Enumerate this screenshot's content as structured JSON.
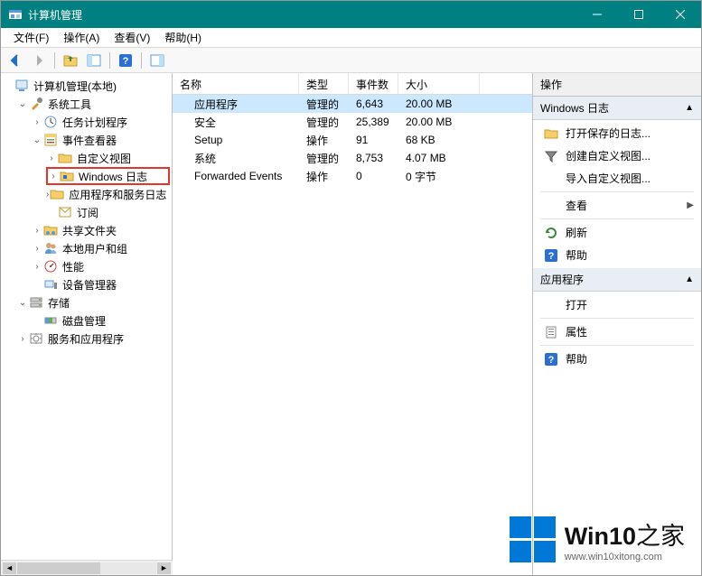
{
  "window": {
    "title": "计算机管理",
    "minimize": "—",
    "maximize": "☐",
    "close": "✕"
  },
  "menu": {
    "file": "文件(F)",
    "action": "操作(A)",
    "view": "查看(V)",
    "help": "帮助(H)"
  },
  "tree": {
    "root": "计算机管理(本地)",
    "system_tools": "系统工具",
    "task_scheduler": "任务计划程序",
    "event_viewer": "事件查看器",
    "custom_views": "自定义视图",
    "windows_logs": "Windows 日志",
    "app_service_logs": "应用程序和服务日志",
    "subscriptions": "订阅",
    "shared_folders": "共享文件夹",
    "local_users": "本地用户和组",
    "performance": "性能",
    "device_manager": "设备管理器",
    "storage": "存储",
    "disk_management": "磁盘管理",
    "services_apps": "服务和应用程序"
  },
  "list": {
    "headers": {
      "name": "名称",
      "type": "类型",
      "count": "事件数",
      "size": "大小"
    },
    "rows": [
      {
        "name": "应用程序",
        "type": "管理的",
        "count": "6,643",
        "size": "20.00 MB",
        "selected": true
      },
      {
        "name": "安全",
        "type": "管理的",
        "count": "25,389",
        "size": "20.00 MB"
      },
      {
        "name": "Setup",
        "type": "操作",
        "count": "91",
        "size": "68 KB"
      },
      {
        "name": "系统",
        "type": "管理的",
        "count": "8,753",
        "size": "4.07 MB"
      },
      {
        "name": "Forwarded Events",
        "type": "操作",
        "count": "0",
        "size": "0 字节"
      }
    ]
  },
  "actions": {
    "header": "操作",
    "section1": "Windows 日志",
    "open_saved_log": "打开保存的日志...",
    "create_custom_view": "创建自定义视图...",
    "import_custom_view": "导入自定义视图...",
    "view": "查看",
    "refresh": "刷新",
    "help": "帮助",
    "section2": "应用程序",
    "open": "打开",
    "properties": "属性",
    "help2": "帮助"
  },
  "watermark": {
    "brand_bold": "Win10",
    "brand_rest": "之家",
    "url": "www.win10xitong.com"
  }
}
